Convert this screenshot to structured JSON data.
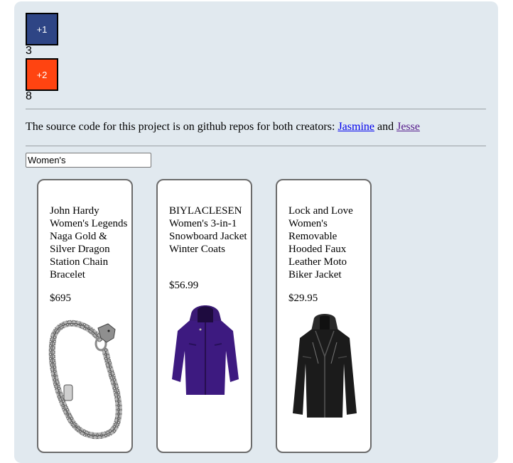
{
  "counters": [
    {
      "label": "+1",
      "count": "3",
      "color": "#2e4585"
    },
    {
      "label": "+2",
      "count": "8",
      "color": "#ff4411"
    }
  ],
  "source": {
    "text": "The source code for this project is on github repos for both creators: ",
    "link1": "Jasmine",
    "joiner": " and ",
    "link2": "Jesse"
  },
  "search": {
    "value": "Women's"
  },
  "products": [
    {
      "title": "John Hardy Women's Legends Naga Gold & Silver Dragon Station Chain Bracelet",
      "price": "$695",
      "image": "bracelet-image"
    },
    {
      "title": "BIYLACLESEN Women's 3-in-1 Snowboard Jacket Winter Coats",
      "price": "$56.99",
      "image": "purple-jacket-image"
    },
    {
      "title": "Lock and Love Women's Removable Hooded Faux Leather Moto Biker Jacket",
      "price": "$29.95",
      "image": "black-leather-jacket-image"
    }
  ]
}
